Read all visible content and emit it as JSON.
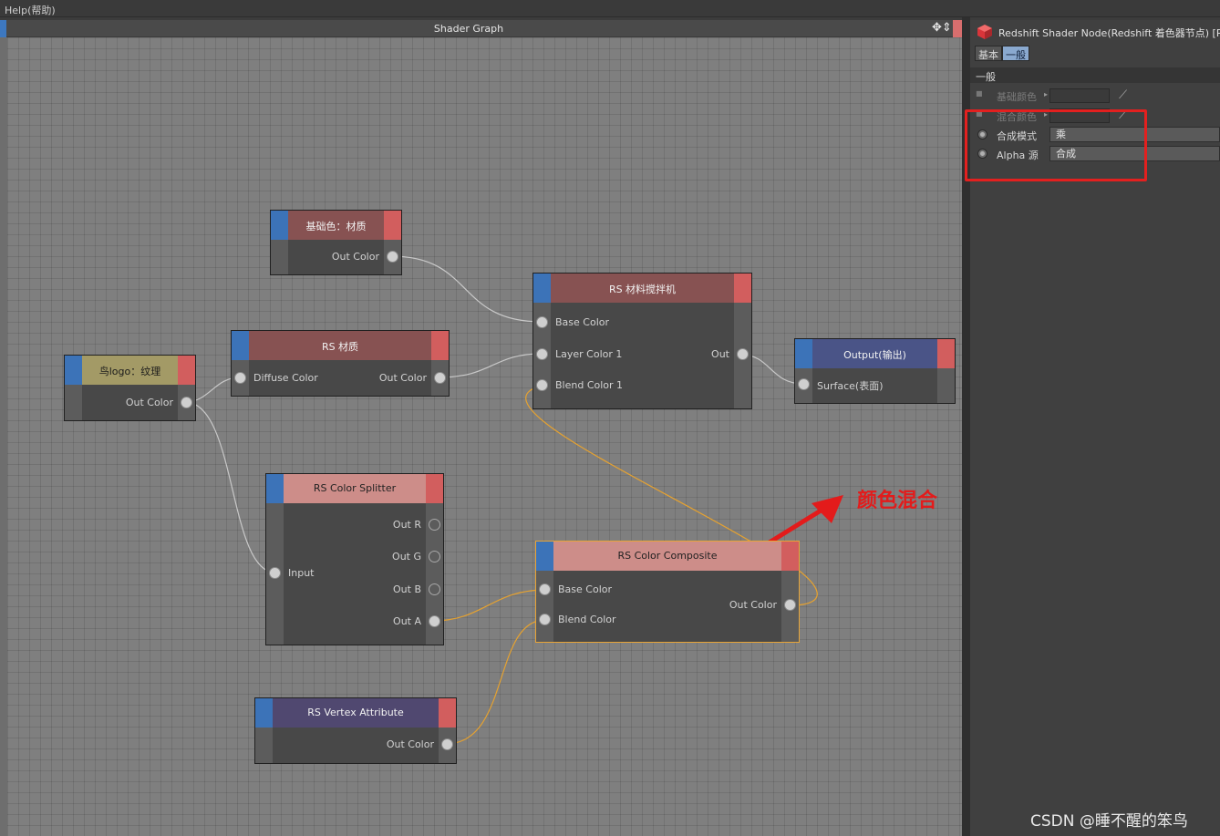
{
  "menubar": {
    "help": "Help(帮助)"
  },
  "graph": {
    "title": "Shader Graph",
    "nav_icon": "move-arrows-icon"
  },
  "nodes": {
    "base_material": {
      "title": "基础色：材质",
      "out": "Out Color"
    },
    "rs_mix": {
      "title": "RS 材料搅拌机",
      "in1": "Base Color",
      "in2": "Layer Color 1",
      "in3": "Blend Color 1",
      "out": "Out"
    },
    "output": {
      "title": "Output(输出)",
      "in1": "Surface(表面)"
    },
    "rs_material": {
      "title": "RS 材质",
      "in1": "Diffuse Color",
      "out": "Out Color"
    },
    "bird_logo": {
      "title": "鸟logo：纹理",
      "out": "Out Color"
    },
    "splitter": {
      "title": "RS Color Splitter",
      "in1": "Input",
      "out_r": "Out R",
      "out_g": "Out G",
      "out_b": "Out B",
      "out_a": "Out A"
    },
    "composite": {
      "title": "RS Color Composite",
      "in1": "Base Color",
      "in2": "Blend Color",
      "out": "Out Color"
    },
    "vertex": {
      "title": "RS Vertex Attribute",
      "out": "Out Color"
    }
  },
  "annotation": {
    "text": "颜色混合"
  },
  "props": {
    "title": "Redshift Shader Node(Redshift 着色器节点) [RS",
    "tabs": [
      "基本",
      "一般"
    ],
    "section": "一般",
    "rows": {
      "base_color": "基础颜色",
      "blend_color": "混合颜色",
      "composite_mode": {
        "label": "合成模式",
        "value": "乘"
      },
      "alpha_source": {
        "label": "Alpha 源",
        "value": "合成"
      }
    }
  },
  "watermark": "CSDN @睡不醒的笨鸟",
  "colors": {
    "wire_gray": "#c8c8c8",
    "wire_orange": "#e6a230",
    "highlight": "#e3201f",
    "annotation": "#e31b1b"
  }
}
